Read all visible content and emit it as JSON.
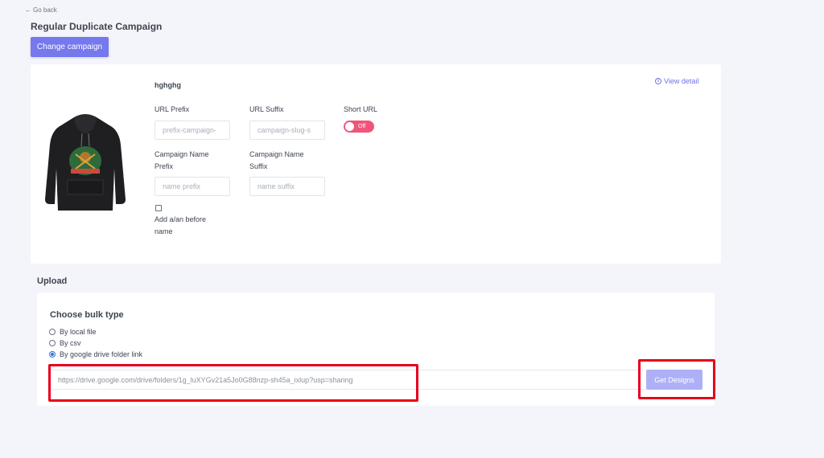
{
  "nav": {
    "go_back": "Go back"
  },
  "page": {
    "title": "Regular Duplicate Campaign",
    "change_campaign": "Change campaign"
  },
  "campaign": {
    "name": "hghghg",
    "view_detail": "View detail",
    "url_prefix_label": "URL Prefix",
    "url_prefix_placeholder": "prefix-campaign-",
    "url_suffix_label": "URL Suffix",
    "url_suffix_placeholder": "campaign-slug-s",
    "short_url_label": "Short URL",
    "short_url_state": "Off",
    "name_prefix_label_line1": "Campaign Name",
    "name_prefix_label_line2": "Prefix",
    "name_prefix_placeholder": "name prefix",
    "name_suffix_label_line1": "Campaign Name",
    "name_suffix_label_line2": "Suffix",
    "name_suffix_placeholder": "name suffix",
    "add_article_label_line1": "Add a/an before",
    "add_article_label_line2": "name"
  },
  "upload": {
    "title": "Upload",
    "bulk_title": "Choose bulk type",
    "options": [
      "By local file",
      "By csv",
      "By google drive folder link"
    ],
    "selected_option": "By google drive folder link",
    "drive_link_value": "https://drive.google.com/drive/folders/1g_luXYGv21a5Jo0G88nzp-sh45a_ixlup?usp=sharing",
    "get_designs": "Get Designs"
  },
  "colors": {
    "primary": "#7678ed",
    "primary_light": "#aeb0f7",
    "toggle_off": "#f0557a",
    "highlight": "#e8001c",
    "background": "#f4f5fa"
  }
}
